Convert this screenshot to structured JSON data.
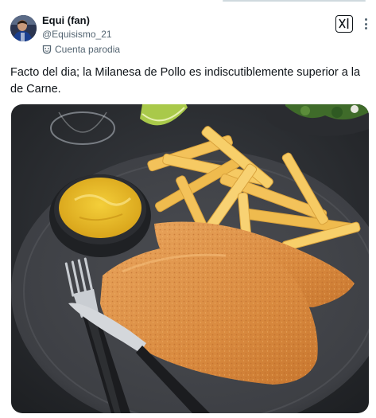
{
  "author": {
    "display_name": "Equi (fan)",
    "handle": "@Equisismo_21",
    "label": "Cuenta parodia"
  },
  "tweet": {
    "text": "Facto del dia; la Milanesa de Pollo es indiscutiblemente superior a la de Carne."
  },
  "media": {
    "subject": "milanesa de pollo con papas fritas y mayonesa"
  },
  "icons": {
    "grok": "grok-icon",
    "more": "more-options-icon",
    "parody": "parody-mask-icon"
  },
  "colors": {
    "text": "#0f1419",
    "secondary": "#536471",
    "background": "#ffffff"
  }
}
